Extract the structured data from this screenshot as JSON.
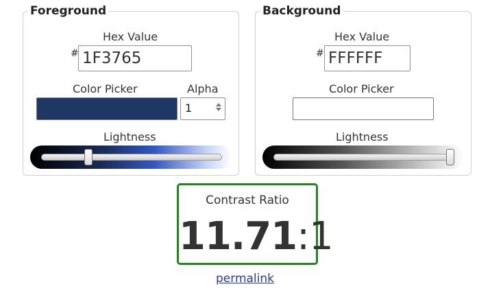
{
  "foreground": {
    "legend": "Foreground",
    "hex_label": "Hex Value",
    "hash": "#",
    "hex_value": "1F3765",
    "color_picker_label": "Color Picker",
    "swatch_color": "#1F3765",
    "alpha_label": "Alpha",
    "alpha_value": "1",
    "lightness_label": "Lightness",
    "lightness_level": 0.25
  },
  "background": {
    "legend": "Background",
    "hex_label": "Hex Value",
    "hash": "#",
    "hex_value": "FFFFFF",
    "color_picker_label": "Color Picker",
    "swatch_color": "#FFFFFF",
    "lightness_label": "Lightness",
    "lightness_level": 1.0
  },
  "contrast": {
    "label": "Contrast Ratio",
    "ratio": "11.71",
    "separator": ":",
    "suffix": "1",
    "border_color": "#1a8a1a"
  },
  "permalink": {
    "label": "permalink"
  }
}
